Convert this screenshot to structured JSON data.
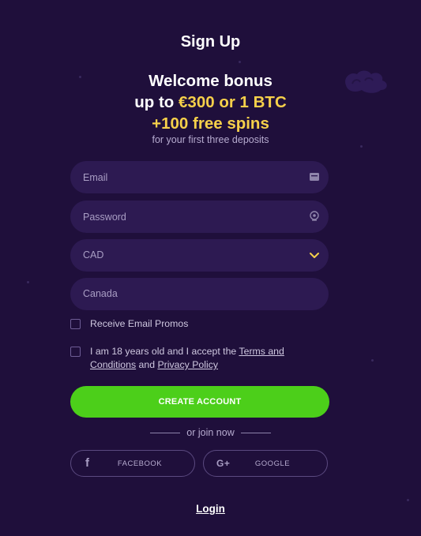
{
  "header": {
    "title": "Sign Up"
  },
  "bonus": {
    "line1": "Welcome bonus",
    "line2_prefix": "up to ",
    "line2_highlight": "€300 or 1 BTC",
    "line3": "+100 free spins",
    "subtitle": "for your first three deposits"
  },
  "form": {
    "email_placeholder": "Email",
    "password_placeholder": "Password",
    "currency_value": "CAD",
    "country_value": "Canada",
    "promos_label": "Receive Email Promos",
    "terms_prefix": "I am 18 years old and I accept the ",
    "terms_link": "Terms and Conditions",
    "terms_and": " and ",
    "privacy_link": "Privacy Policy",
    "create_label": "CREATE ACCOUNT"
  },
  "social": {
    "or_join": "or join now",
    "facebook_label": "FACEBOOK",
    "google_label": "GOOGLE",
    "facebook_icon": "f",
    "google_icon": "G+"
  },
  "footer": {
    "login_label": "Login"
  },
  "colors": {
    "background": "#1f0f3b",
    "field": "#2d1a52",
    "accent": "#4ccf1a",
    "gold": "#f6d04a"
  }
}
